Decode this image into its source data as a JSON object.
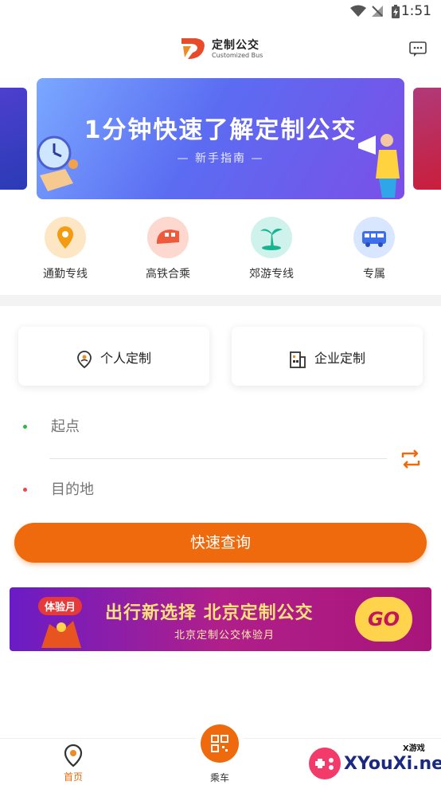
{
  "status_bar": {
    "time": "1:51"
  },
  "header": {
    "logo_title": "定制公交",
    "logo_subtitle": "Customized Bus"
  },
  "banner": {
    "title": "1分钟快速了解定制公交",
    "subtitle": "— 新手指南 —",
    "slide_count": 3,
    "active_slide": 3
  },
  "categories": [
    {
      "label": "通勤专线",
      "icon": "commute-pin-icon",
      "color": "#f5a623"
    },
    {
      "label": "高铁合乘",
      "icon": "train-icon",
      "color": "#f26b4f"
    },
    {
      "label": "郊游专线",
      "icon": "palm-tree-icon",
      "color": "#2ec7a8"
    },
    {
      "label": "专属",
      "icon": "bus-icon",
      "color": "#4a7ef2"
    }
  ],
  "types": {
    "personal": {
      "label": "个人定制",
      "icon": "person-pin-icon"
    },
    "enterprise": {
      "label": "企业定制",
      "icon": "building-icon"
    }
  },
  "route": {
    "origin_placeholder": "起点",
    "destination_placeholder": "目的地"
  },
  "query_button": {
    "label": "快速查询"
  },
  "promo": {
    "badge": "体验月",
    "title": "出行新选择 北京定制公交",
    "subtitle": "北京定制公交体验月",
    "go": "GO"
  },
  "tabs": [
    {
      "label": "首页",
      "icon": "home-pin-icon",
      "active": true
    },
    {
      "label": "乘车",
      "icon": "qr-code-icon",
      "active": false
    }
  ],
  "watermark": {
    "text": "XYouXi.net",
    "small": "X游戏"
  },
  "colors": {
    "accent": "#ee6a0c",
    "origin_dot": "#2db84a",
    "destination_dot": "#e84a4a"
  }
}
